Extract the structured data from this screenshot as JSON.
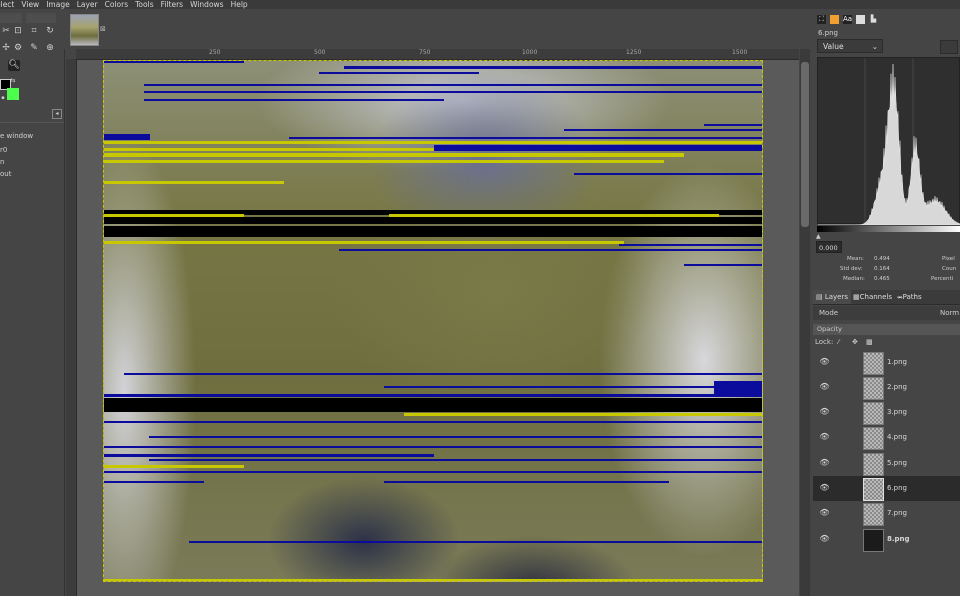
{
  "menubar": {
    "items": [
      "elect",
      "View",
      "Image",
      "Layer",
      "Colors",
      "Tools",
      "Filters",
      "Windows",
      "Help"
    ]
  },
  "toolbox": {
    "labels": [
      "e window",
      "r0",
      "n",
      "out"
    ]
  },
  "ruler": {
    "top_labels": [
      "250",
      "500",
      "750",
      "1000",
      "1250",
      "1500"
    ]
  },
  "image": {
    "name": "satellite image with glitch stripes"
  },
  "histogram": {
    "layer_name": "6.png",
    "channel": "Value",
    "range_start": "0.000",
    "stats": {
      "mean_label": "Mean:",
      "mean": "0.494",
      "stddev_label": "Std dev:",
      "stddev": "0.164",
      "median_label": "Median:",
      "median": "0.465",
      "pixels_label": "Pixel",
      "count_label": "Coun",
      "percentile_label": "Percenti"
    }
  },
  "layers_panel": {
    "tabs": [
      "Layers",
      "Channels",
      "Paths"
    ],
    "mode_label": "Mode",
    "mode_value": "Norm",
    "opacity_label": "Opacity",
    "lock_label": "Lock:",
    "layers": [
      {
        "name": "1.png",
        "selected": false,
        "dark": false,
        "bold": false
      },
      {
        "name": "2.png",
        "selected": false,
        "dark": false,
        "bold": false
      },
      {
        "name": "3.png",
        "selected": false,
        "dark": false,
        "bold": false
      },
      {
        "name": "4.png",
        "selected": false,
        "dark": false,
        "bold": false
      },
      {
        "name": "5.png",
        "selected": false,
        "dark": false,
        "bold": false
      },
      {
        "name": "6.png",
        "selected": true,
        "dark": false,
        "bold": false
      },
      {
        "name": "7.png",
        "selected": false,
        "dark": false,
        "bold": false
      },
      {
        "name": "8.png",
        "selected": false,
        "dark": true,
        "bold": true
      }
    ]
  },
  "colors": {
    "fg": "#000000",
    "bg": "#4cff4c",
    "stripe_blue": "#0b0b9c",
    "stripe_yellow": "#c8c800",
    "stripe_black": "#000000"
  }
}
